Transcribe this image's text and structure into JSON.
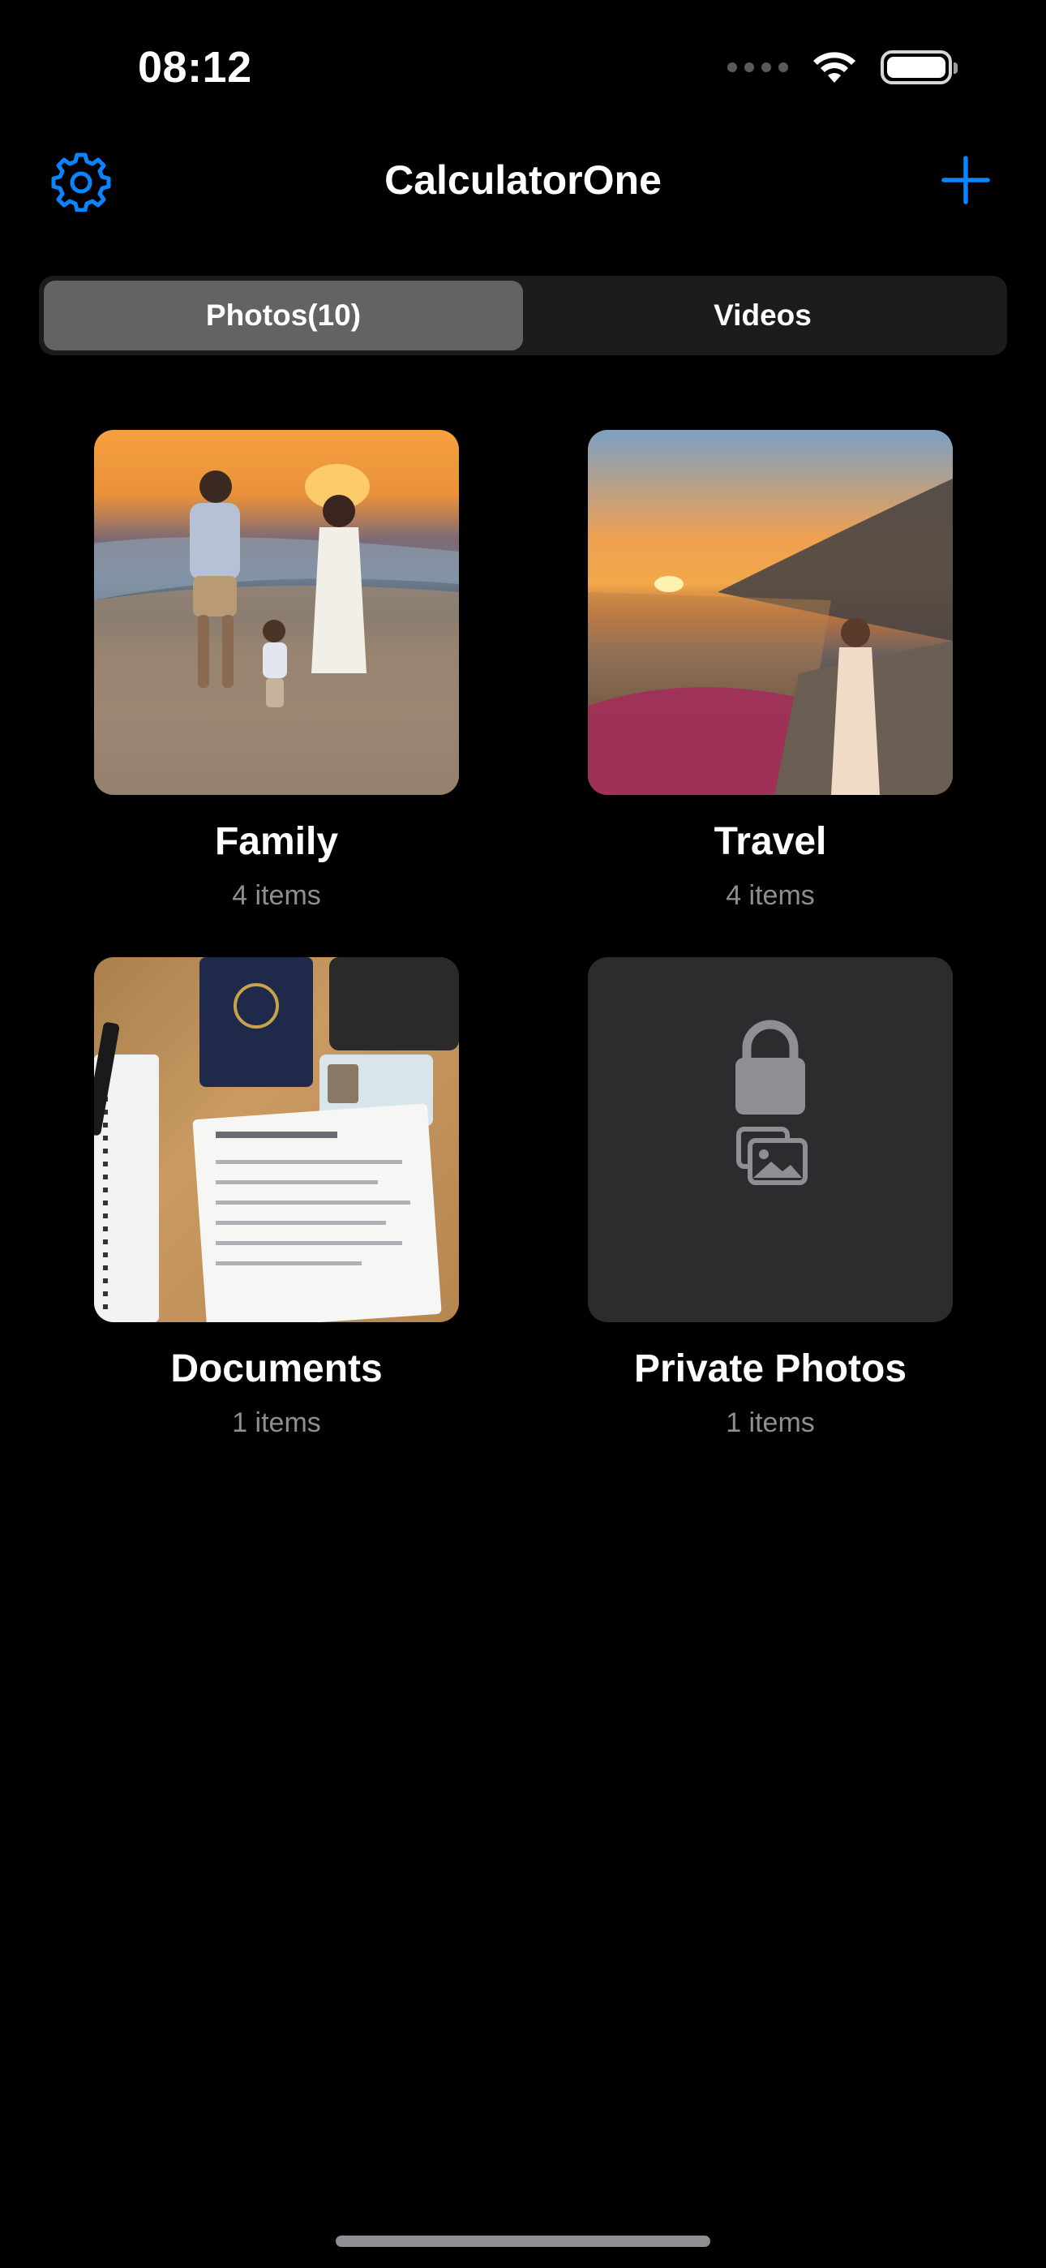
{
  "status_bar": {
    "time": "08:12"
  },
  "nav": {
    "title": "CalculatorOne",
    "settings_icon": "gear-icon",
    "add_icon": "plus-icon",
    "accent_color": "#0a84ff"
  },
  "segmented": {
    "tabs": [
      {
        "label": "Photos(10)",
        "selected": true
      },
      {
        "label": "Videos",
        "selected": false
      }
    ]
  },
  "albums": [
    {
      "name": "Family",
      "count": "4 items",
      "thumbnail": "photo"
    },
    {
      "name": "Travel",
      "count": "4 items",
      "thumbnail": "photo"
    },
    {
      "name": "Documents",
      "count": "1 items",
      "thumbnail": "photo"
    },
    {
      "name": "Private Photos",
      "count": "1 items",
      "thumbnail": "lock-icon"
    }
  ]
}
